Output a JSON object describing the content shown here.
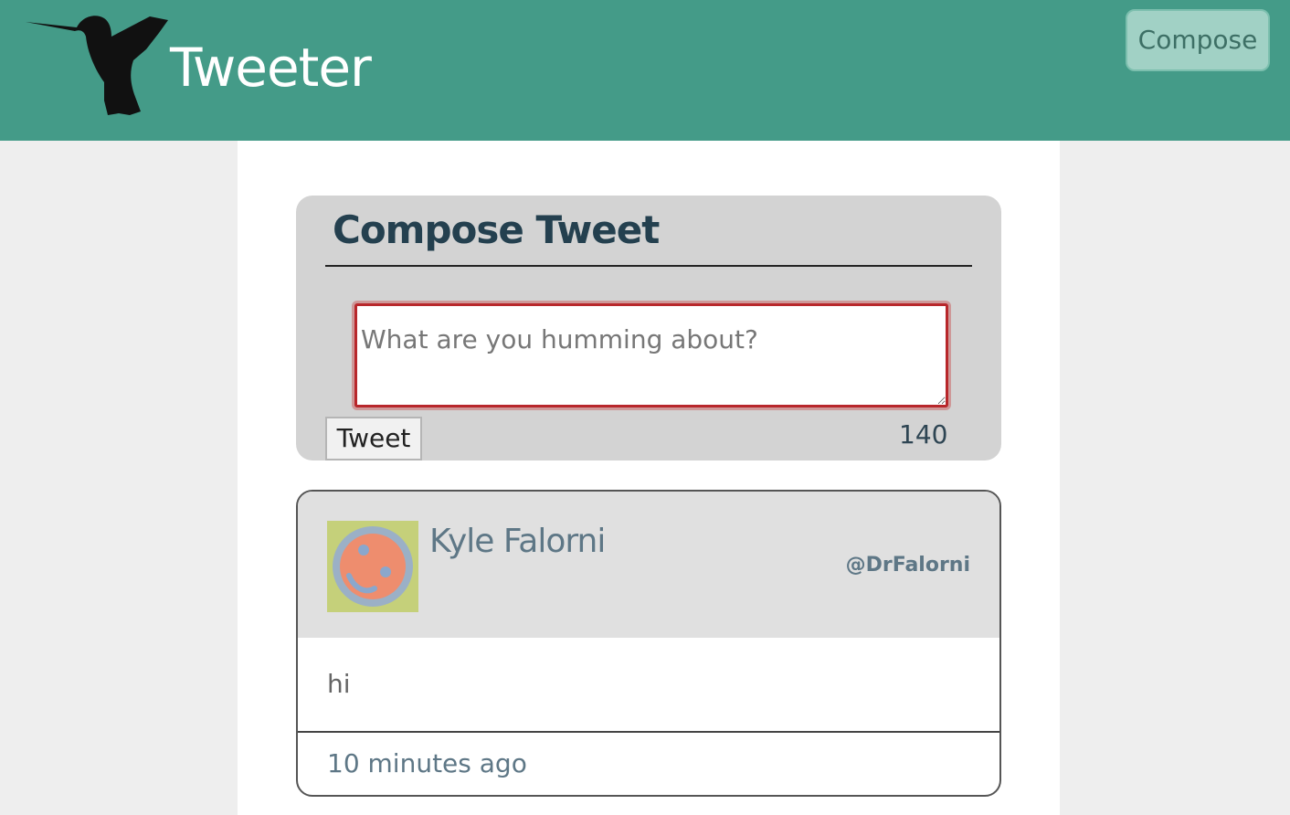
{
  "header": {
    "brand": "Tweeter",
    "logo_icon": "hummingbird-icon",
    "compose_label": "Compose",
    "background_color": "#449b88"
  },
  "compose": {
    "heading": "Compose Tweet",
    "placeholder": "What are you humming about?",
    "value": "",
    "submit_label": "Tweet",
    "counter": "140",
    "error_border_color": "#b8272b"
  },
  "tweets": [
    {
      "avatar_icon": "avatar-icon",
      "name": "Kyle Falorni",
      "handle": "@DrFalorni",
      "text": "hi",
      "timestamp": "10 minutes ago"
    }
  ]
}
